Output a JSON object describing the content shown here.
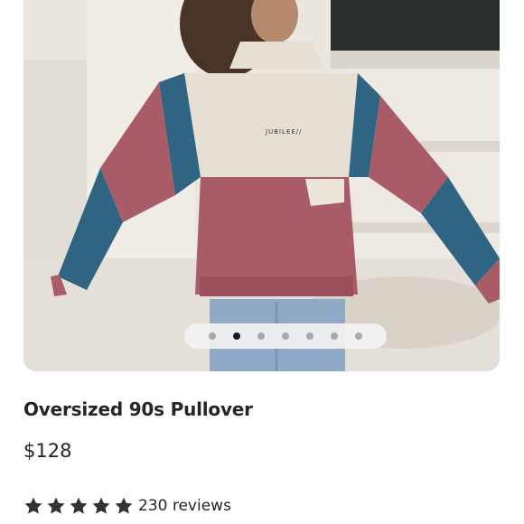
{
  "product": {
    "title": "Oversized 90s Pullover",
    "price": "$128",
    "rating": 5,
    "reviews_label": "230 reviews",
    "brand_print": "JUBILEE//"
  },
  "gallery": {
    "image_count": 7,
    "active_index": 1
  },
  "colors": {
    "text": "#252525",
    "star": "#333333",
    "dot_active": "#111111",
    "dot_inactive": "#a8a8a8"
  }
}
